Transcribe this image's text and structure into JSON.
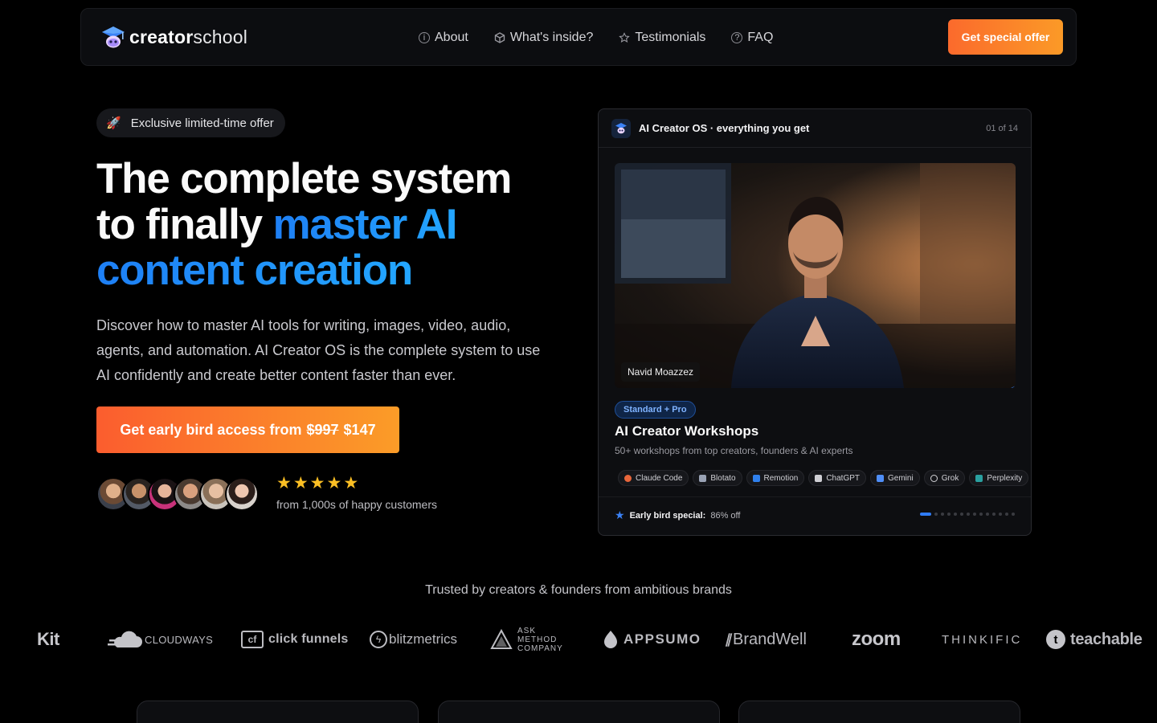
{
  "nav": {
    "logo_bold": "creator",
    "logo_light": "school",
    "links": [
      {
        "label": "About",
        "icon": "info-icon"
      },
      {
        "label": "What's inside?",
        "icon": "box-icon"
      },
      {
        "label": "Testimonials",
        "icon": "star-icon"
      },
      {
        "label": "FAQ",
        "icon": "question-icon"
      }
    ],
    "cta": "Get special offer"
  },
  "hero": {
    "badge": "Exclusive limited-time offer",
    "headline_line1": "The complete system",
    "headline_line2_plain": "to finally ",
    "headline_line2_accent": "master AI",
    "headline_line3_accent": "content creation",
    "lead": "Discover how to master AI tools for writing, images, video, audio, agents, and automation. AI Creator OS is the complete system to use AI confidently and create better content faster than ever.",
    "cta_prefix": "Get early bird access from",
    "cta_old_price": "$997",
    "cta_price": "$147",
    "rating_stars": 5,
    "social_proof": "from 1,000s of happy customers"
  },
  "card": {
    "title": "AI Creator OS · everything you get",
    "counter": "01 of 14",
    "video_name": "Navid Moazzez",
    "tier": "Standard + Pro",
    "heading": "AI Creator Workshops",
    "subheading": "50+ workshops from top creators, founders & AI experts",
    "tools": [
      {
        "label": "Claude Code",
        "color": "#e8663b"
      },
      {
        "label": "Blotato",
        "color": "#9aa3b5"
      },
      {
        "label": "Remotion",
        "color": "#2f80ed"
      },
      {
        "label": "ChatGPT",
        "color": "#cfcfd4"
      },
      {
        "label": "Gemini",
        "color": "#4f8ef7"
      },
      {
        "label": "Grok",
        "color": "#d4d4d8"
      },
      {
        "label": "Perplexity",
        "color": "#2aa0a0"
      }
    ],
    "early_label": "Early bird special:",
    "early_value": "86% off",
    "slide_count": 14,
    "active_slide": 1
  },
  "trusted": {
    "heading": "Trusted by creators & founders from ambitious brands",
    "brands": [
      "Kit",
      "CLOUDWAYS",
      "click funnels",
      "blitzmetrics",
      "ASK METHOD COMPANY",
      "APPSUMO",
      "BrandWell",
      "zoom",
      "THINKIFIC",
      "teachable"
    ]
  },
  "colors": {
    "accent_orange": "#fb7a2a",
    "accent_blue": "#1e8af8",
    "star_gold": "#fbbf24"
  }
}
